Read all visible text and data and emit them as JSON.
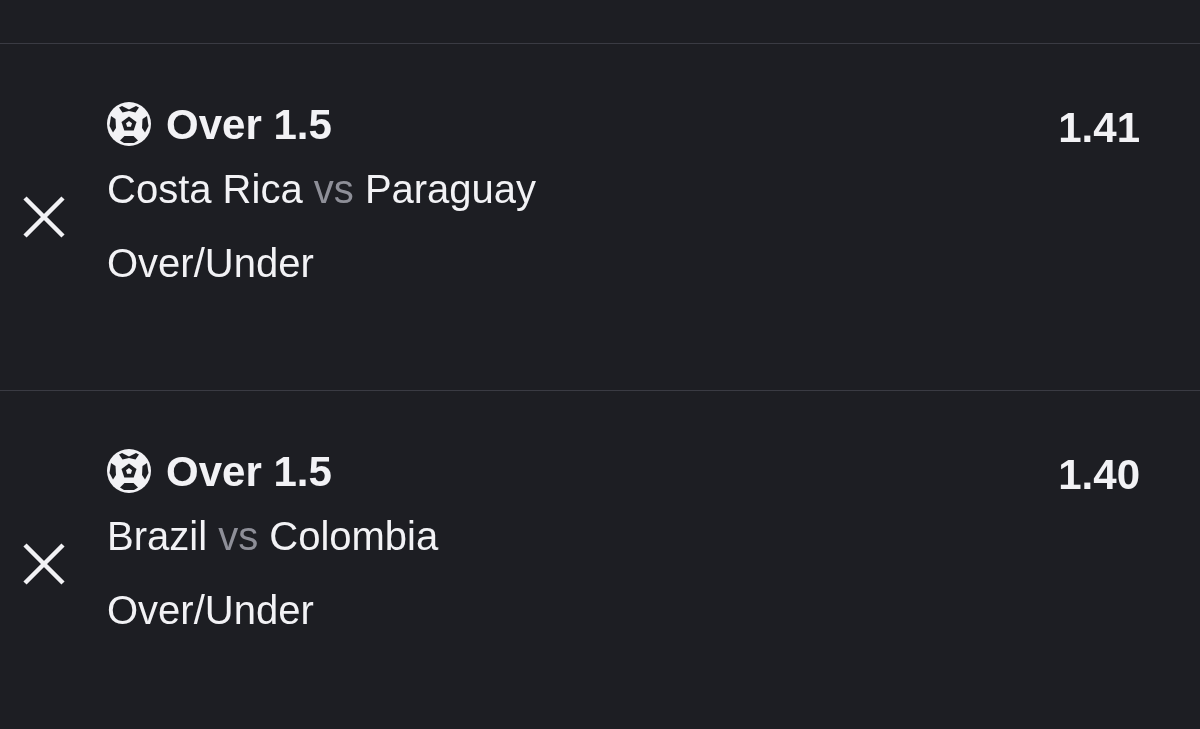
{
  "bets": [
    {
      "selection": "Over 1.5",
      "teams": {
        "home": "Costa Rica",
        "separator": "vs",
        "away": "Paraguay"
      },
      "market": "Over/Under",
      "odds": "1.41"
    },
    {
      "selection": "Over 1.5",
      "teams": {
        "home": "Brazil",
        "separator": "vs",
        "away": "Colombia"
      },
      "market": "Over/Under",
      "odds": "1.40"
    }
  ]
}
